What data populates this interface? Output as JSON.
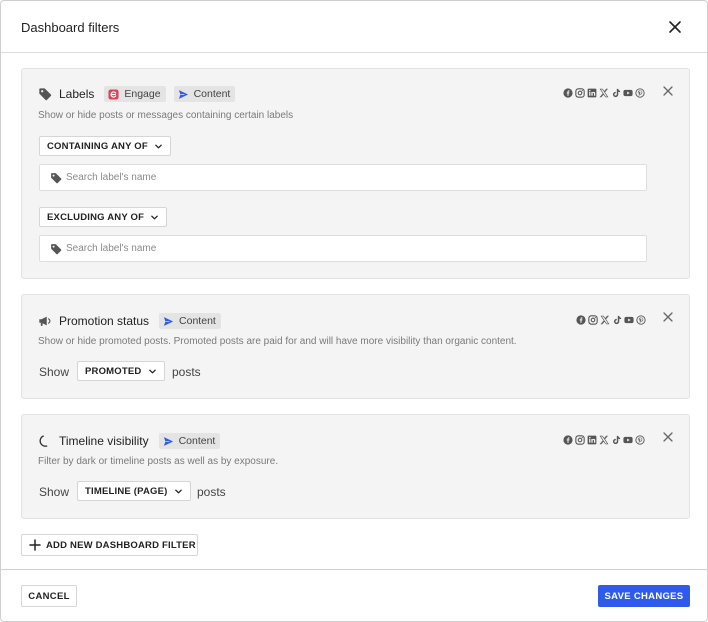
{
  "header": {
    "title": "Dashboard filters",
    "close_icon": "close-icon"
  },
  "tags": {
    "engage": "Engage",
    "content": "Content"
  },
  "colors": {
    "accent": "#2f5bea",
    "engage": "#e0405a",
    "content": "#2f5bea"
  },
  "cards": [
    {
      "name": "Labels",
      "icon": "tag-icon",
      "description": "Show or hide posts or messages containing certain labels",
      "socials": [
        "facebook-icon",
        "instagram-icon",
        "linkedin-icon",
        "x-icon",
        "tiktok-icon",
        "youtube-icon",
        "pinterest-icon"
      ],
      "include_label": "CONTAINING ANY OF",
      "include_placeholder": "Search label's name",
      "exclude_label": "EXCLUDING ANY OF",
      "exclude_placeholder": "Search label's name"
    },
    {
      "name": "Promotion status",
      "icon": "megaphone-icon",
      "description": "Show or hide promoted posts. Promoted posts are paid for and will have more visibility than organic content.",
      "socials": [
        "facebook-icon",
        "instagram-icon",
        "x-icon",
        "tiktok-icon",
        "youtube-icon",
        "pinterest-icon"
      ],
      "show_label": "Show",
      "selected": "PROMOTED",
      "suffix": "posts"
    },
    {
      "name": "Timeline visibility",
      "icon": "moon-icon",
      "description": "Filter by dark or timeline posts as well as by exposure.",
      "socials": [
        "facebook-icon",
        "instagram-icon",
        "linkedin-icon",
        "x-icon",
        "tiktok-icon",
        "youtube-icon",
        "pinterest-icon"
      ],
      "show_label": "Show",
      "selected": "TIMELINE (PAGE)",
      "suffix": "posts"
    }
  ],
  "add_filter": "ADD NEW DASHBOARD FILTER",
  "footer": {
    "cancel": "CANCEL",
    "save": "SAVE CHANGES"
  }
}
